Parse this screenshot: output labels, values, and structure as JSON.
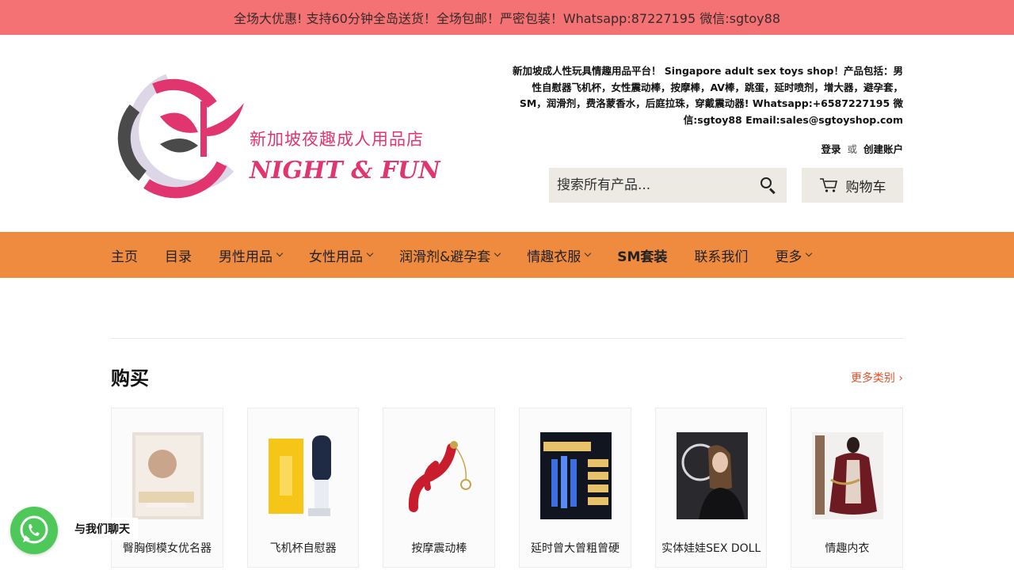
{
  "announcement": "全场大优惠! 支持60分钟全岛送货！全场包邮！严密包装！Whatsapp:87227195 微信:sgtoy88",
  "brand": {
    "name_cn": "新加坡夜趣成人用品店",
    "name_en": "NIGHT & FUN",
    "colors": {
      "primary": "#e0356e",
      "dark": "#4a4a4a",
      "light": "#dcd6e6"
    }
  },
  "tagline": "新加坡成人性玩具情趣用品平台！ Singapore adult sex toys shop！产品包括：男性自慰器飞机杯，女性震动棒，按摩棒，AV棒，跳蛋，延时喷剂，增大器，避孕套，SM，润滑剂，费洛蒙香水，后庭拉珠，穿戴震动器! Whatsapp:+6587227195 微信:sgtoy88 Email:sales@sgtoyshop.com",
  "account": {
    "login": "登录",
    "or": "或",
    "register": "创建账户"
  },
  "search": {
    "placeholder": "搜索所有产品...",
    "icon": "search-icon"
  },
  "cart": {
    "label": "购物车",
    "icon": "cart-icon"
  },
  "nav": [
    {
      "label": "主页",
      "dropdown": false
    },
    {
      "label": "目录",
      "dropdown": false
    },
    {
      "label": "男性用品",
      "dropdown": true
    },
    {
      "label": "女性用品",
      "dropdown": true
    },
    {
      "label": "润滑剂&避孕套",
      "dropdown": true
    },
    {
      "label": "情趣衣服",
      "dropdown": true
    },
    {
      "label": "SM套装",
      "dropdown": false
    },
    {
      "label": "联系我们",
      "dropdown": false
    },
    {
      "label": "更多",
      "dropdown": true
    }
  ],
  "section": {
    "title": "购买",
    "more": "更多类别 ›"
  },
  "categories": [
    {
      "label": "臀胸倒模女优名器"
    },
    {
      "label": "飞机杯自慰器"
    },
    {
      "label": "按摩震动棒"
    },
    {
      "label": "延时曾大曾粗曾硬"
    },
    {
      "label": "实体娃娃SEX DOLL"
    },
    {
      "label": "情趣内衣"
    }
  ],
  "whatsapp": {
    "label": "与我们聊天",
    "color": "#4fc85a"
  },
  "colors": {
    "announcement_bg": "#f47174",
    "nav_bg": "#ee8b3e",
    "link": "#e0512b",
    "search_bg": "#eceae3"
  }
}
